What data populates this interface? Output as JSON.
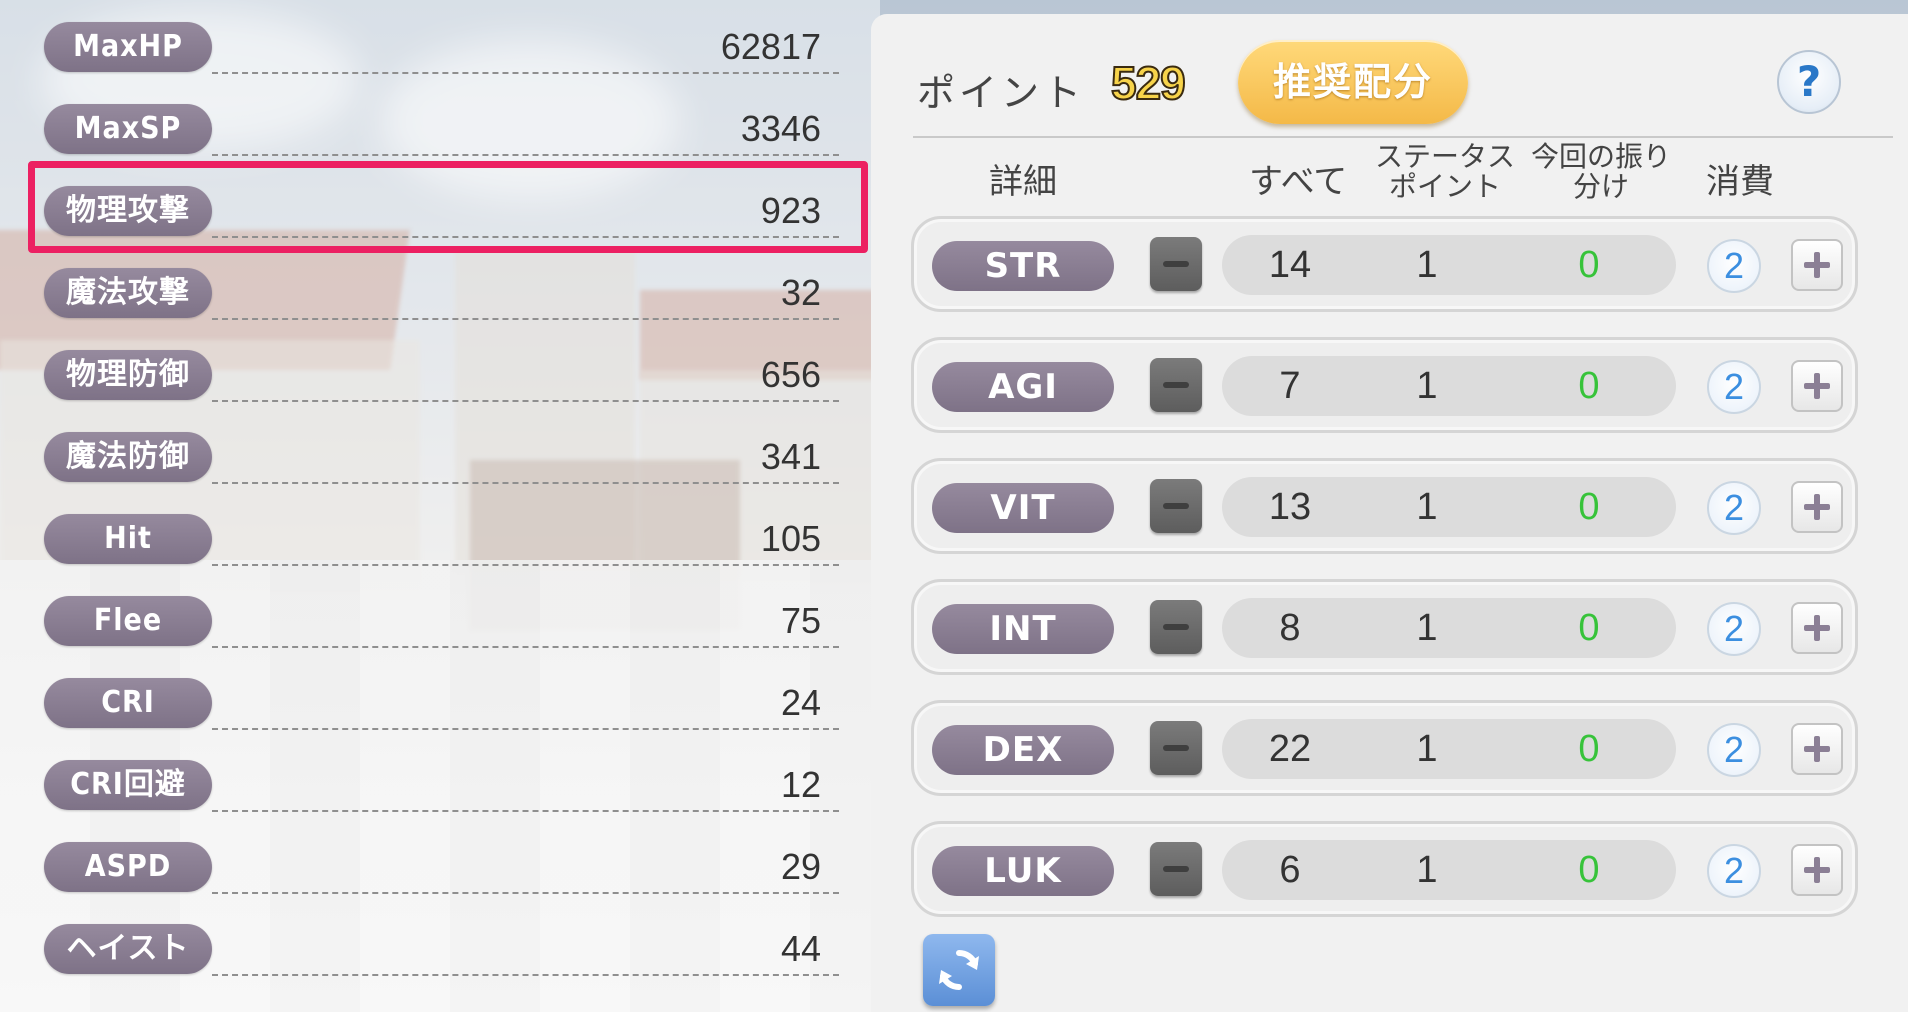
{
  "stats": [
    {
      "label": "MaxHP",
      "value": "62817"
    },
    {
      "label": "MaxSP",
      "value": "3346"
    },
    {
      "label": "物理攻撃",
      "value": "923"
    },
    {
      "label": "魔法攻撃",
      "value": "32"
    },
    {
      "label": "物理防御",
      "value": "656"
    },
    {
      "label": "魔法防御",
      "value": "341"
    },
    {
      "label": "Hit",
      "value": "105"
    },
    {
      "label": "Flee",
      "value": "75"
    },
    {
      "label": "CRI",
      "value": "24"
    },
    {
      "label": "CRI回避",
      "value": "12"
    },
    {
      "label": "ASPD",
      "value": "29"
    },
    {
      "label": "ヘイスト",
      "value": "44"
    }
  ],
  "highlight_color": "#ec2062",
  "panel": {
    "points_label": "ポイント",
    "points_value": "529",
    "recommend_button": "推奨配分",
    "help_button": "?",
    "headers": {
      "detail": "詳細",
      "all": "すべて",
      "status_points_line1": "ステータス",
      "status_points_line2": "ポイント",
      "this_time_line1": "今回の振り",
      "this_time_line2": "分け",
      "cost": "消費"
    },
    "attributes": [
      {
        "name": "STR",
        "all": "14",
        "status_points": "1",
        "allocated": "0",
        "cost": "2"
      },
      {
        "name": "AGI",
        "all": "7",
        "status_points": "1",
        "allocated": "0",
        "cost": "2"
      },
      {
        "name": "VIT",
        "all": "13",
        "status_points": "1",
        "allocated": "0",
        "cost": "2"
      },
      {
        "name": "INT",
        "all": "8",
        "status_points": "1",
        "allocated": "0",
        "cost": "2"
      },
      {
        "name": "DEX",
        "all": "22",
        "status_points": "1",
        "allocated": "0",
        "cost": "2"
      },
      {
        "name": "LUK",
        "all": "6",
        "status_points": "1",
        "allocated": "0",
        "cost": "2"
      }
    ],
    "icons": {
      "minus": "minus-icon",
      "plus": "plus-icon",
      "reset": "refresh-icon",
      "help": "question-icon"
    }
  }
}
